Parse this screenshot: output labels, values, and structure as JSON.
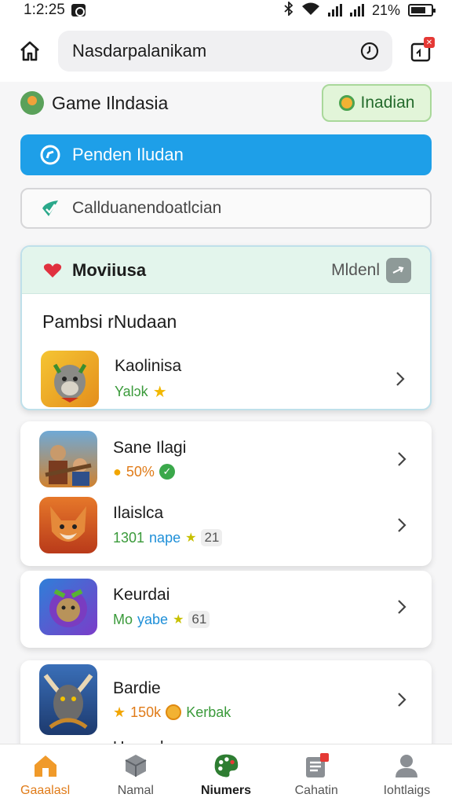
{
  "status_bar": {
    "time": "1:2:25",
    "battery": "21%"
  },
  "top_bar": {
    "search_text": "Nasdarpalanikam"
  },
  "section": {
    "title": "Game Ilndasia",
    "action_label": "Inadian"
  },
  "blue_button": {
    "label": "Penden Iludan"
  },
  "outline_field": {
    "text": "Calldu​anendoatlcian"
  },
  "card1": {
    "header_title": "Moviiusa",
    "header_right": "Mldenl",
    "subtitle": "Pambsi rNudaan",
    "items": [
      {
        "name": "Kaolinisa",
        "meta": "Yalɔk"
      }
    ]
  },
  "card2": {
    "items": [
      {
        "name": "Sane Ilagi",
        "meta": "50%"
      },
      {
        "name": "Ilaislca",
        "meta_a": "1301",
        "meta_b": "nape",
        "meta_c": "21"
      }
    ]
  },
  "card3": {
    "items": [
      {
        "name": "Keurdai",
        "meta_a": "Mo",
        "meta_b": "yabe",
        "meta_c": "61"
      }
    ]
  },
  "card4": {
    "items": [
      {
        "name": "Bardie",
        "meta_a": "150k",
        "meta_b": "Kerbak"
      },
      {
        "name": "Uramnk"
      }
    ]
  },
  "tabs": [
    {
      "label": "Gaaalasl",
      "icon": "home-icon"
    },
    {
      "label": "Namal",
      "icon": "box-icon"
    },
    {
      "label": "Niumers",
      "icon": "palette-icon"
    },
    {
      "label": "Cahatin",
      "icon": "news-icon"
    },
    {
      "label": "Iohtlaigs",
      "icon": "person-icon"
    }
  ],
  "colors": {
    "accent_blue": "#1e9fe8",
    "accent_green": "#3a9a3a",
    "accent_orange": "#e07b18"
  }
}
